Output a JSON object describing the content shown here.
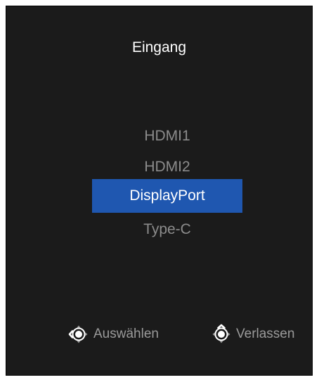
{
  "menu": {
    "title": "Eingang",
    "items": [
      {
        "label": "HDMI1",
        "selected": false
      },
      {
        "label": "HDMI2",
        "selected": false
      },
      {
        "label": "DisplayPort",
        "selected": true
      },
      {
        "label": "Type-C",
        "selected": false
      }
    ]
  },
  "footer": {
    "select_label": "Auswählen",
    "select_icon": "joystick-left-icon",
    "exit_label": "Verlassen",
    "exit_icon": "joystick-up-icon"
  },
  "colors": {
    "background": "#1b1b1b",
    "highlight": "#1f57b0",
    "title_text": "#ffffff",
    "item_text": "#8c8c8c",
    "hint_text": "#9a9a9a"
  }
}
